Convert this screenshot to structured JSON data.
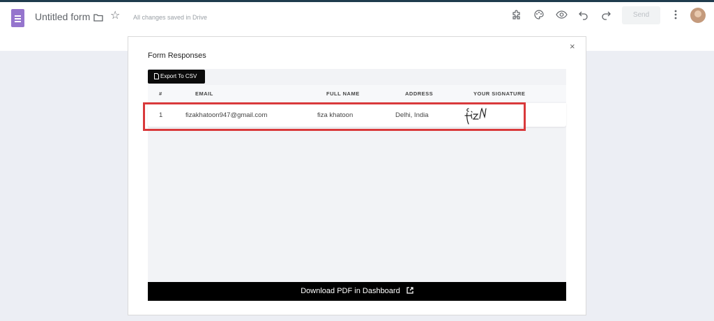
{
  "header": {
    "doc_title": "Untitled form",
    "saved_status": "All changes saved in Drive",
    "send_label": "Send",
    "icons": [
      "forms-icon",
      "folder-icon",
      "star-icon",
      "addon-icon",
      "palette-icon",
      "preview-icon",
      "undo-icon",
      "redo-icon",
      "more-icon",
      "avatar"
    ]
  },
  "modal": {
    "title": "Form Responses",
    "close": "×",
    "export_label": "Export To CSV",
    "columns": [
      "#",
      "EMAIL",
      "FULL NAME",
      "ADDRESS",
      "YOUR SIGNATURE"
    ],
    "rows": [
      {
        "num": "1",
        "email": "fizakhatoon947@gmail.com",
        "name": "fiza khatoon",
        "address": "Delhi, India"
      }
    ],
    "download_label": "Download PDF in Dashboard"
  },
  "colors": {
    "highlight": "#d9393b",
    "forms_purple": "#9575cd",
    "button_black": "#0b0b0b"
  }
}
